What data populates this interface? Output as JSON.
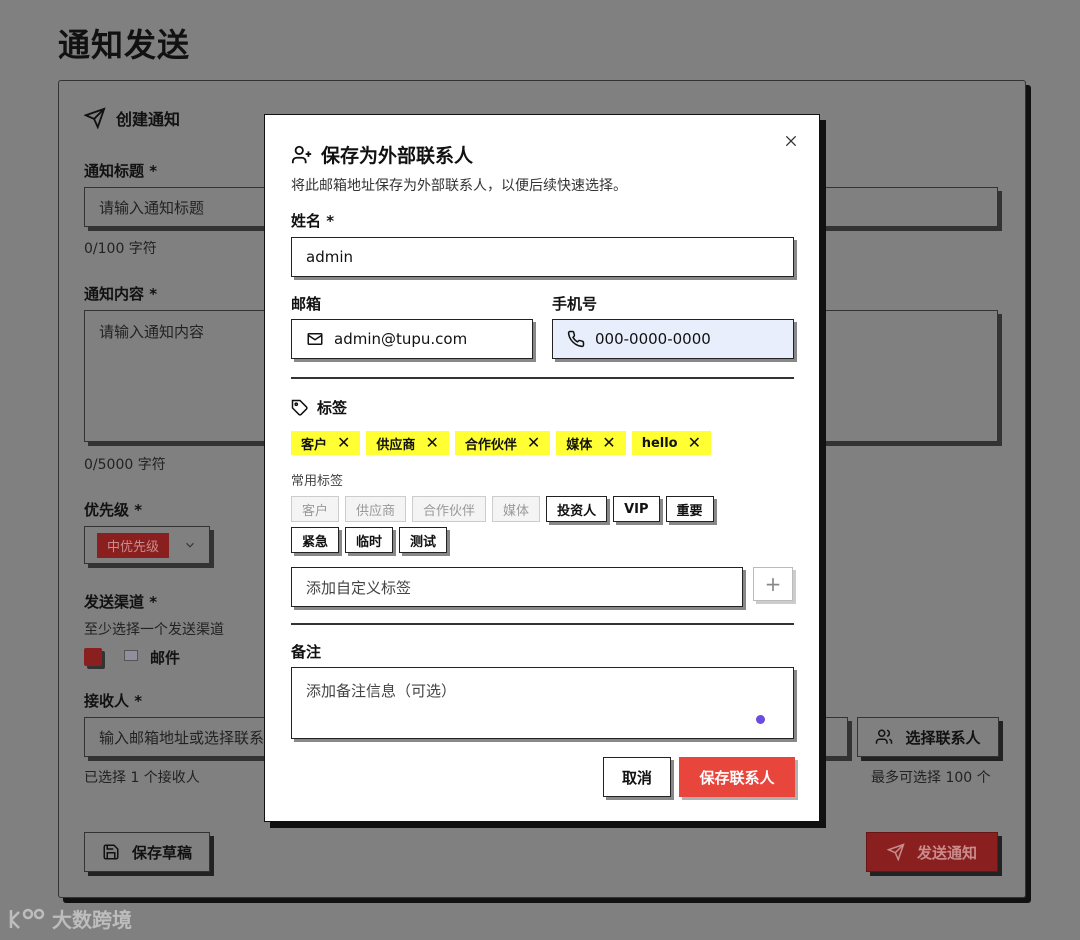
{
  "page": {
    "title": "通知发送"
  },
  "form": {
    "card_title": "创建通知",
    "title_label": "通知标题 *",
    "title_placeholder": "请输入通知标题",
    "title_count": "0/100 字符",
    "content_label": "通知内容 *",
    "content_placeholder": "请输入通知内容",
    "content_count": "0/5000 字符",
    "priority_label": "优先级 *",
    "priority_value": "中优先级",
    "channel_label": "发送渠道 *",
    "channel_hint": "至少选择一个发送渠道",
    "channel_email": "邮件",
    "recipient_label": "接收人 *",
    "recipient_placeholder": "输入邮箱地址或选择联系",
    "recipient_selected": "已选择 1 个接收人",
    "recipient_max": "最多可选择 100 个",
    "select_contact": "选择联系人",
    "save_draft": "保存草稿",
    "send": "发送通知"
  },
  "modal": {
    "title": "保存为外部联系人",
    "subtitle": "将此邮箱地址保存为外部联系人，以便后续快速选择。",
    "name_label": "姓名 *",
    "name_value": "admin",
    "email_label": "邮箱",
    "email_value": "admin@tupu.com",
    "phone_label": "手机号",
    "phone_placeholder": "000-0000-0000",
    "tags_label": "标签",
    "selected_tags": [
      "客户",
      "供应商",
      "合作伙伴",
      "媒体",
      "hello"
    ],
    "common_tags_label": "常用标签",
    "common_tags_row1": [
      "客户",
      "供应商",
      "合作伙伴",
      "媒体",
      "投资人",
      "VIP",
      "重要"
    ],
    "common_tags_row2": [
      "紧急",
      "临时",
      "测试"
    ],
    "custom_tag_placeholder": "添加自定义标签",
    "remark_label": "备注",
    "remark_placeholder": "添加备注信息（可选）",
    "cancel": "取消",
    "save": "保存联系人"
  },
  "watermark": "大数跨境",
  "colors": {
    "accent": "#e8453c",
    "tag_yellow": "#ffff33",
    "active_input": "#e8eefc"
  }
}
